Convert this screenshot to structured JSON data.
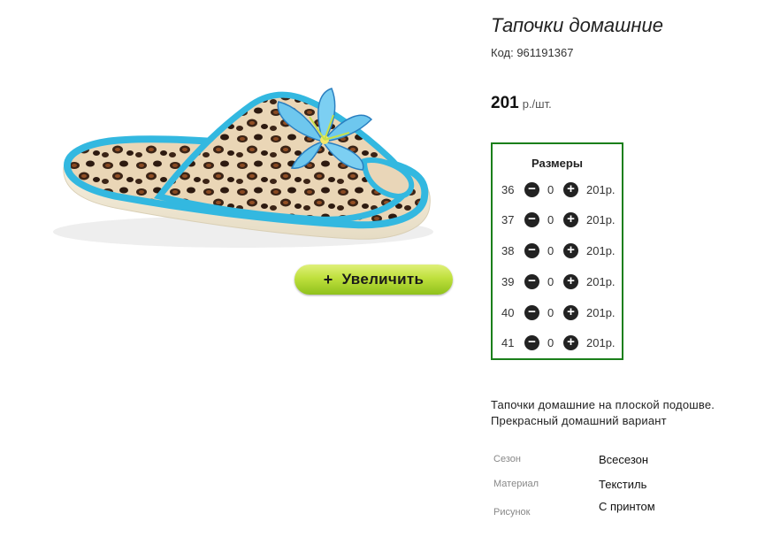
{
  "product": {
    "title": "Тапочки домашние",
    "code": "Код: 961191367",
    "price": "201",
    "price_unit": "р./шт.",
    "zoom_label": "Увеличить",
    "zoom_icon": "+"
  },
  "sizes": {
    "title": "Размеры",
    "rows": [
      {
        "size": "36",
        "qty": "0",
        "price": "201р."
      },
      {
        "size": "37",
        "qty": "0",
        "price": "201р."
      },
      {
        "size": "38",
        "qty": "0",
        "price": "201р."
      },
      {
        "size": "39",
        "qty": "0",
        "price": "201р."
      },
      {
        "size": "40",
        "qty": "0",
        "price": "201р."
      },
      {
        "size": "41",
        "qty": "0",
        "price": "201р."
      }
    ]
  },
  "description": {
    "line1": "Тапочки домашние на плоской подошве.",
    "line2": "Прекрасный домашний вариант"
  },
  "attributes": [
    {
      "label": "Сезон",
      "value": "Всесезон"
    },
    {
      "label": "Материал",
      "value": "Текстиль"
    },
    {
      "label": "Рисунок",
      "value": "С принтом"
    }
  ],
  "colors": {
    "border_green": "#1a7f1a",
    "button_green": "#bfe03d",
    "slipper_trim": "#33b8e0",
    "leopard_base": "#e9d3b3"
  }
}
